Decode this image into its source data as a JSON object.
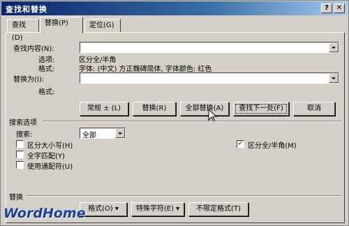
{
  "window": {
    "title": "查找和替换",
    "help_glyph": "?",
    "close_glyph": "✕"
  },
  "tabs": [
    {
      "label": "查找(D)"
    },
    {
      "label": "替换(P)"
    },
    {
      "label": "定位(G)"
    }
  ],
  "find": {
    "label": "查找内容(N):",
    "value": "",
    "options_label": "选项:",
    "options_value": "区分全/半角",
    "format_label": "格式:",
    "format_value": "字体: (中文) 方正魏碑简体, 字体颜色: 红色"
  },
  "replace": {
    "label": "替换为(I):",
    "value": "",
    "format_label": "格式:"
  },
  "buttons": {
    "normal": "常规 ± (L)",
    "replace": "替换(R)",
    "replace_all": "全部替换(A)",
    "find_next": "查找下一处(F)",
    "cancel": "取消"
  },
  "search_options": {
    "section_label": "搜索选项",
    "search_label": "搜索:",
    "search_value": "全部",
    "match_case": "区分大小写(H)",
    "whole_word": "全字匹配(Y)",
    "wildcards": "使用通配符(U)",
    "full_half_width": "区分全/半角(M)",
    "full_half_checked": "✓"
  },
  "replace_section": {
    "label": "替换",
    "format_button": "格式(O) ▾",
    "special_button": "特殊字符(E) ▾",
    "no_format_button": "不限定格式(T)"
  },
  "watermark": "WordHome"
}
